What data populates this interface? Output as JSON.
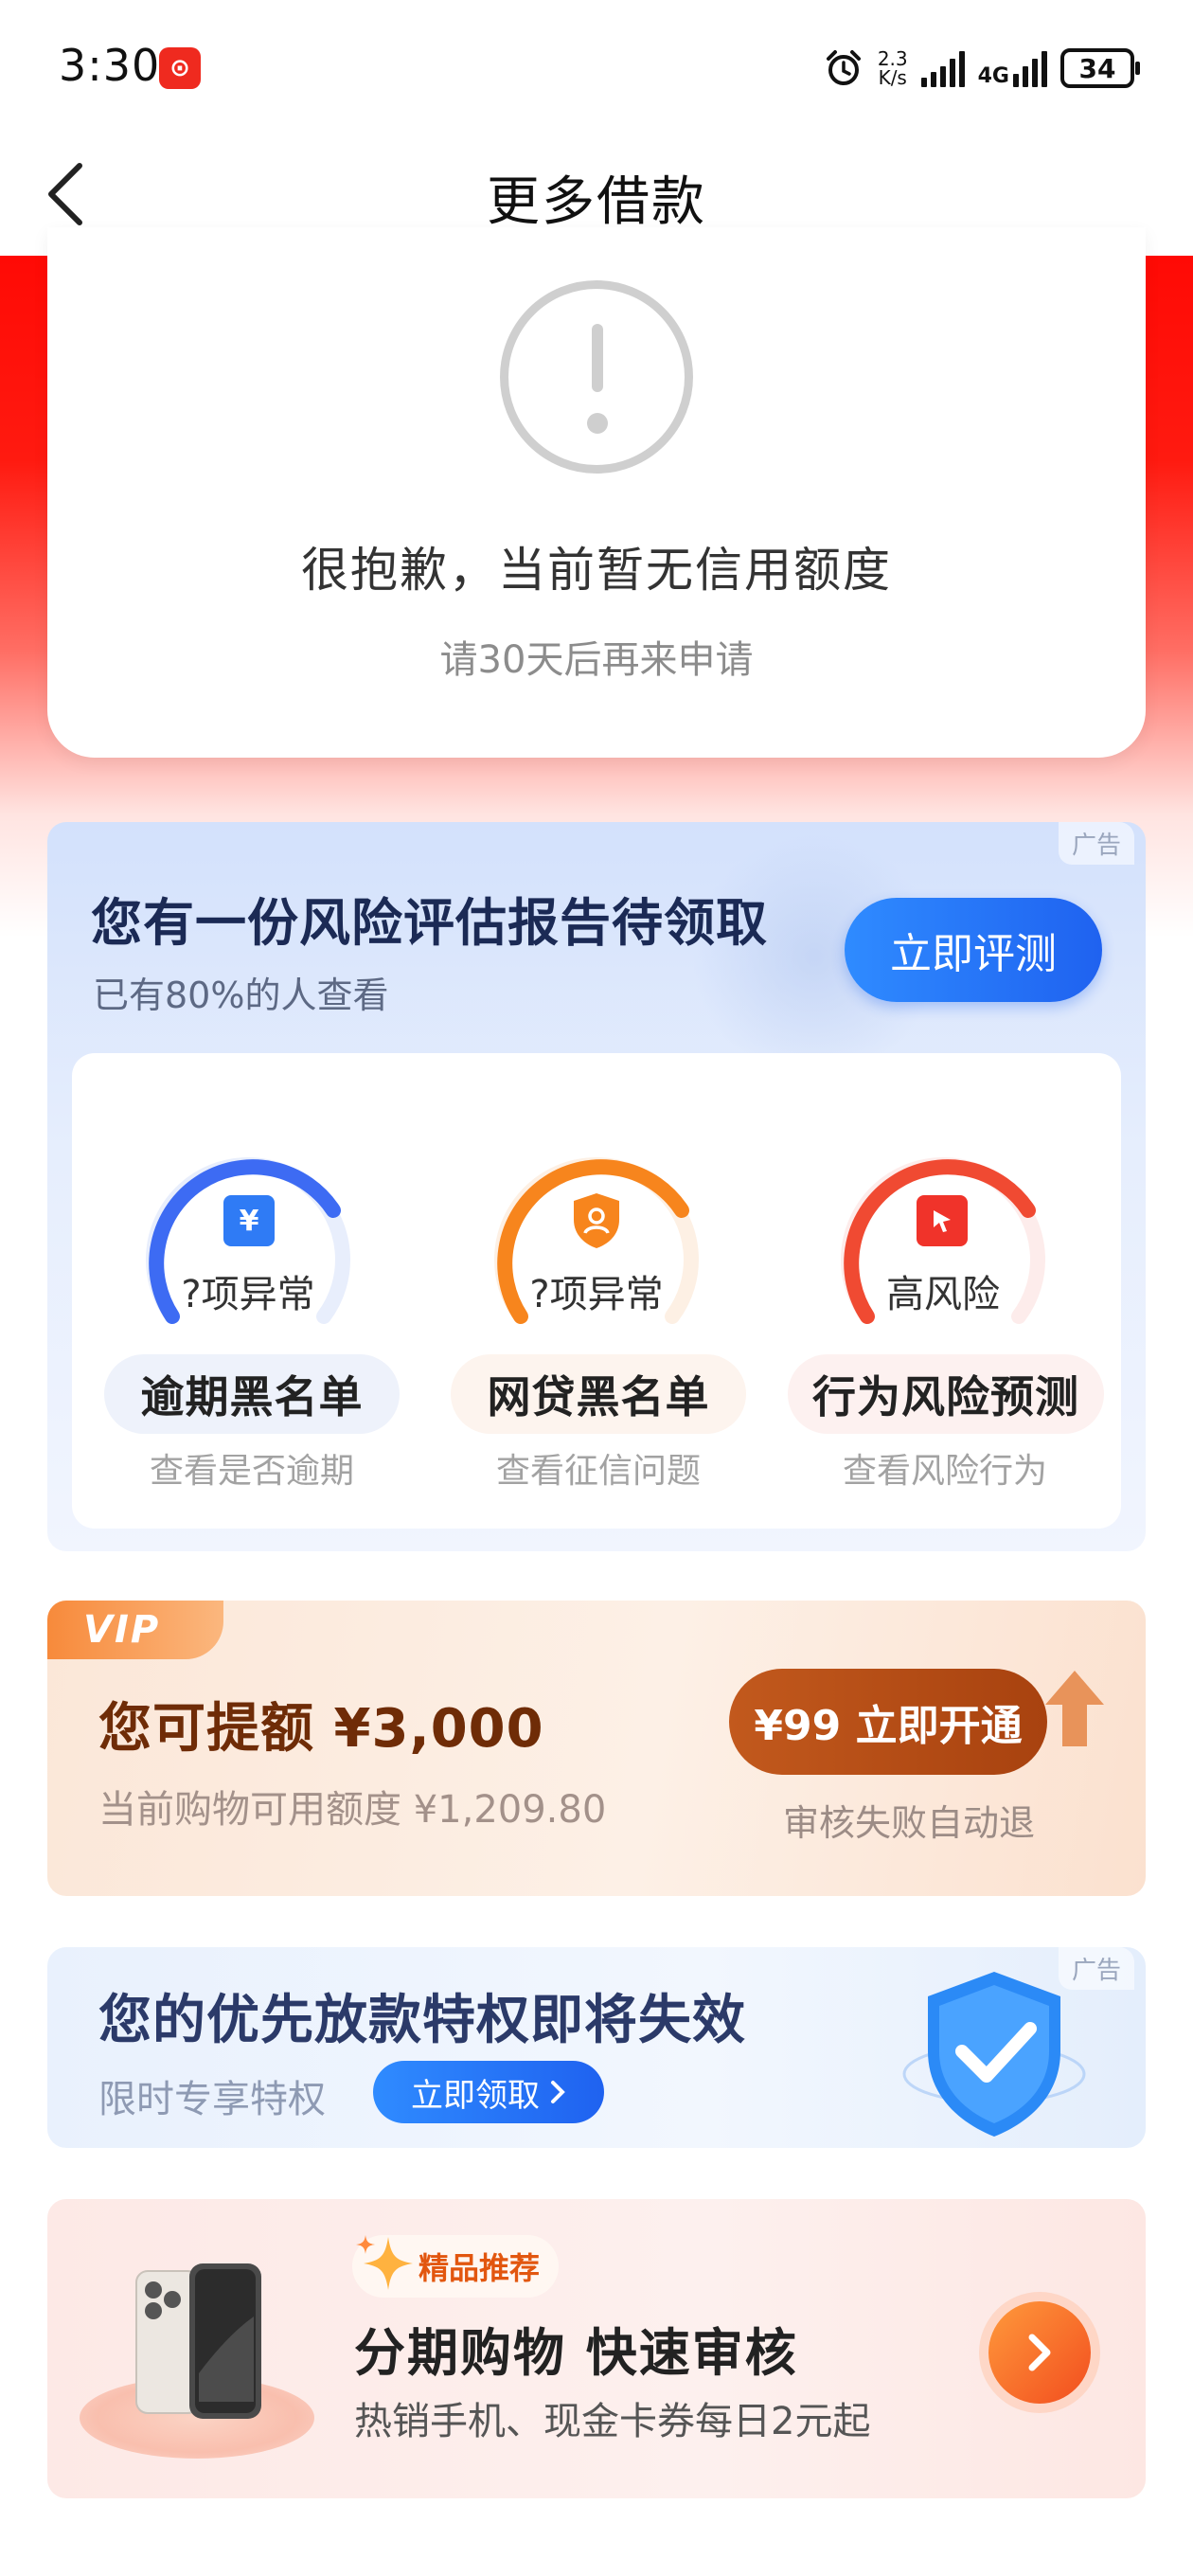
{
  "status_bar": {
    "time": "3:30",
    "net_speed_value": "2.3",
    "net_speed_unit": "K/s",
    "network_type": "4G",
    "battery": "34"
  },
  "nav": {
    "title": "更多借款"
  },
  "notice": {
    "title": "很抱歉，当前暂无信用额度",
    "subtitle": "请30天后再来申请"
  },
  "risk_report": {
    "ad_label": "广告",
    "title": "您有一份风险评估报告待领取",
    "subtitle": "已有80%的人查看",
    "button": "立即评测",
    "items": [
      {
        "icon": "yen-icon",
        "status": "?项异常",
        "name": "逾期黑名单",
        "desc": "查看是否逾期",
        "color": "#3d6bf3"
      },
      {
        "icon": "user-shield-icon",
        "status": "?项异常",
        "name": "网贷黑名单",
        "desc": "查看征信问题",
        "color": "#f7851d"
      },
      {
        "icon": "cursor-icon",
        "status": "高风险",
        "name": "行为风险预测",
        "desc": "查看风险行为",
        "color": "#f04a32"
      }
    ]
  },
  "vip": {
    "tag": "VIP",
    "title": "您可提额 ¥3,000",
    "subtitle": "当前购物可用额度 ¥1,209.80",
    "button": "¥99 立即开通",
    "button_note": "审核失败自动退"
  },
  "priority": {
    "ad_label": "广告",
    "title": "您的优先放款特权即将失效",
    "subtitle": "限时专享特权",
    "button": "立即领取"
  },
  "shopping": {
    "tag": "精品推荐",
    "title": "分期购物 快速审核",
    "subtitle": "热销手机、现金卡券每日2元起"
  },
  "colors": {
    "brand_red": "#ff0a05",
    "primary_blue": "#1f62f0",
    "vip_brown": "#a8420f",
    "shop_orange": "#f24d1e"
  }
}
